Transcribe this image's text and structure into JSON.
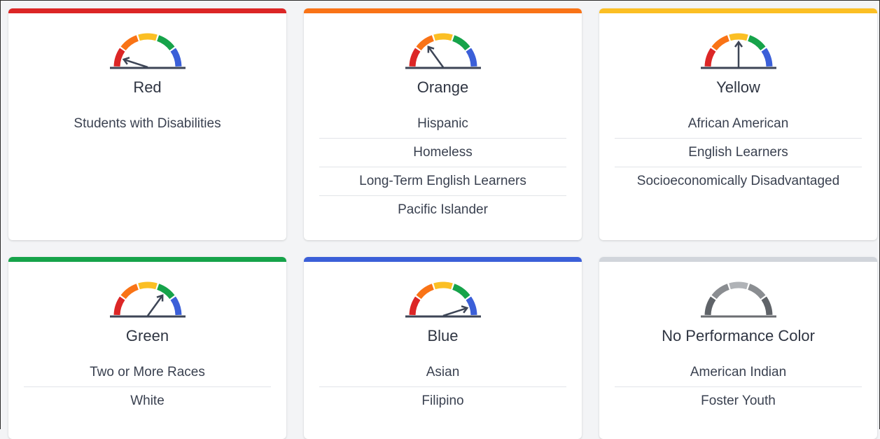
{
  "colors": {
    "red": "#dc2626",
    "orange": "#f97316",
    "yellow": "#fbbf24",
    "green": "#16a34a",
    "blue": "#3b5fd8",
    "gray": "#d1d5db",
    "needle": "#3d4556"
  },
  "cards": [
    {
      "title": "Red",
      "color_key": "red",
      "needle_level": 0,
      "groups": [
        "Students with Disabilities"
      ]
    },
    {
      "title": "Orange",
      "color_key": "orange",
      "needle_level": 1,
      "groups": [
        "Hispanic",
        "Homeless",
        "Long-Term English Learners",
        "Pacific Islander"
      ]
    },
    {
      "title": "Yellow",
      "color_key": "yellow",
      "needle_level": 2,
      "groups": [
        "African American",
        "English Learners",
        "Socioeconomically Disadvantaged"
      ]
    },
    {
      "title": "Green",
      "color_key": "green",
      "needle_level": 3,
      "groups": [
        "Two or More Races",
        "White"
      ]
    },
    {
      "title": "Blue",
      "color_key": "blue",
      "needle_level": 4,
      "groups": [
        "Asian",
        "Filipino"
      ]
    },
    {
      "title": "No Performance Color",
      "color_key": "gray",
      "needle_level": null,
      "groups": [
        "American Indian",
        "Foster Youth"
      ]
    }
  ]
}
